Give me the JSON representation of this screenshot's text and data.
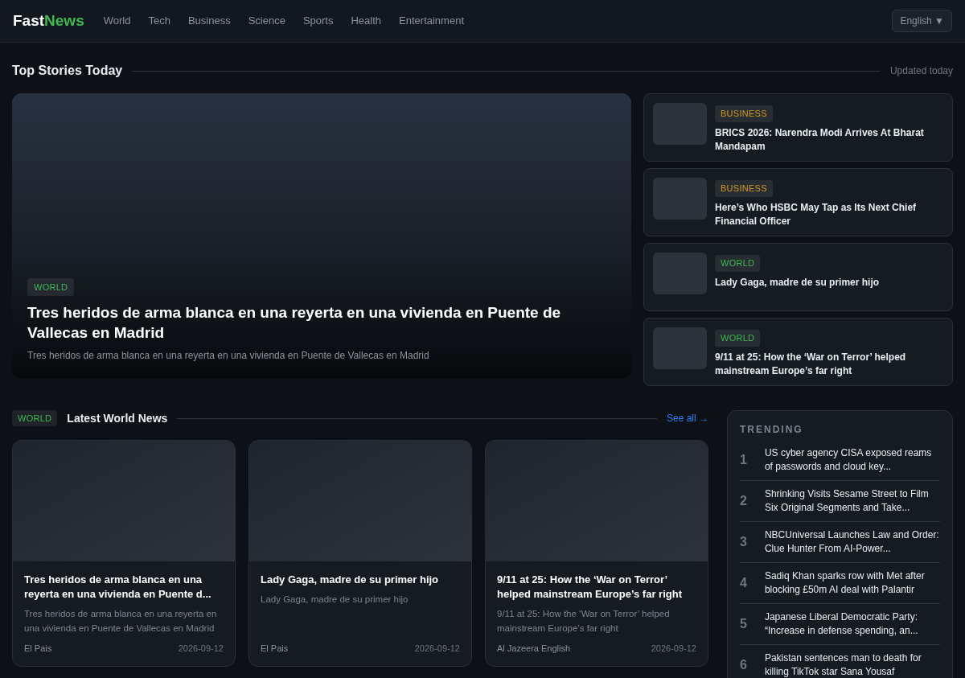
{
  "header": {
    "logo": {
      "first": "Fast",
      "second": "News"
    },
    "nav": [
      {
        "label": "World"
      },
      {
        "label": "Tech"
      },
      {
        "label": "Business"
      },
      {
        "label": "Science"
      },
      {
        "label": "Sports"
      },
      {
        "label": "Health"
      },
      {
        "label": "Entertainment"
      }
    ],
    "language": "English ▼"
  },
  "top_stories": {
    "title": "Top Stories Today",
    "updated": "Updated today",
    "hero": {
      "category": {
        "label": "WORLD",
        "color": "#3fb950"
      },
      "headline": "Tres heridos de arma blanca en una reyerta en una vivienda en Puente de Vallecas en Madrid",
      "summary": "Tres heridos de arma blanca en una reyerta en una vivienda en Puente de Vallecas en Madrid"
    },
    "side": [
      {
        "category": {
          "label": "BUSINESS",
          "color": "#d29922"
        },
        "headline": "BRICS 2026: Narendra Modi Arrives At Bharat Mandapam"
      },
      {
        "category": {
          "label": "BUSINESS",
          "color": "#d29922"
        },
        "headline": "Here’s Who HSBC May Tap as Its Next Chief Financial Officer"
      },
      {
        "category": {
          "label": "WORLD",
          "color": "#3fb950"
        },
        "headline": "Lady Gaga, madre de su primer hijo"
      },
      {
        "category": {
          "label": "WORLD",
          "color": "#3fb950"
        },
        "headline": "9/11 at 25: How the ‘War on Terror’ helped mainstream Europe’s far right"
      }
    ]
  },
  "latest": {
    "tag": {
      "label": "WORLD",
      "color": "#3fb950"
    },
    "title": "Latest World News",
    "see_all": "See all →",
    "cards": [
      {
        "headline": "Tres heridos de arma blanca en una reyerta en una vivienda en Puente d...",
        "summary": "Tres heridos de arma blanca en una reyerta en una vivienda en Puente de Vallecas en Madrid",
        "source": "El Pais",
        "date": "2026-09-12"
      },
      {
        "headline": "Lady Gaga, madre de su primer hijo",
        "summary": "Lady Gaga, madre de su primer hijo",
        "source": "El Pais",
        "date": "2026-09-12"
      },
      {
        "headline": "9/11 at 25: How the ‘War on Terror’ helped mainstream Europe’s far right",
        "summary": "9/11 at 25: How the ‘War on Terror’ helped mainstream Europe’s far right",
        "source": "Al Jazeera English",
        "date": "2026-09-12"
      }
    ]
  },
  "trending": {
    "title": "TRENDING",
    "items": [
      {
        "rank": "1",
        "headline": "US cyber agency CISA exposed reams of passwords and cloud key..."
      },
      {
        "rank": "2",
        "headline": "Shrinking Visits Sesame Street to Film Six Original Segments and Take..."
      },
      {
        "rank": "3",
        "headline": "NBCUniversal Launches Law and Order: Clue Hunter From AI-Power..."
      },
      {
        "rank": "4",
        "headline": "Sadiq Khan sparks row with Met after blocking £50m AI deal with Palantir"
      },
      {
        "rank": "5",
        "headline": "Japanese Liberal Democratic Party: “Increase in defense spending, an..."
      },
      {
        "rank": "6",
        "headline": "Pakistan sentences man to death for killing TikTok star Sana Yousaf"
      }
    ]
  }
}
